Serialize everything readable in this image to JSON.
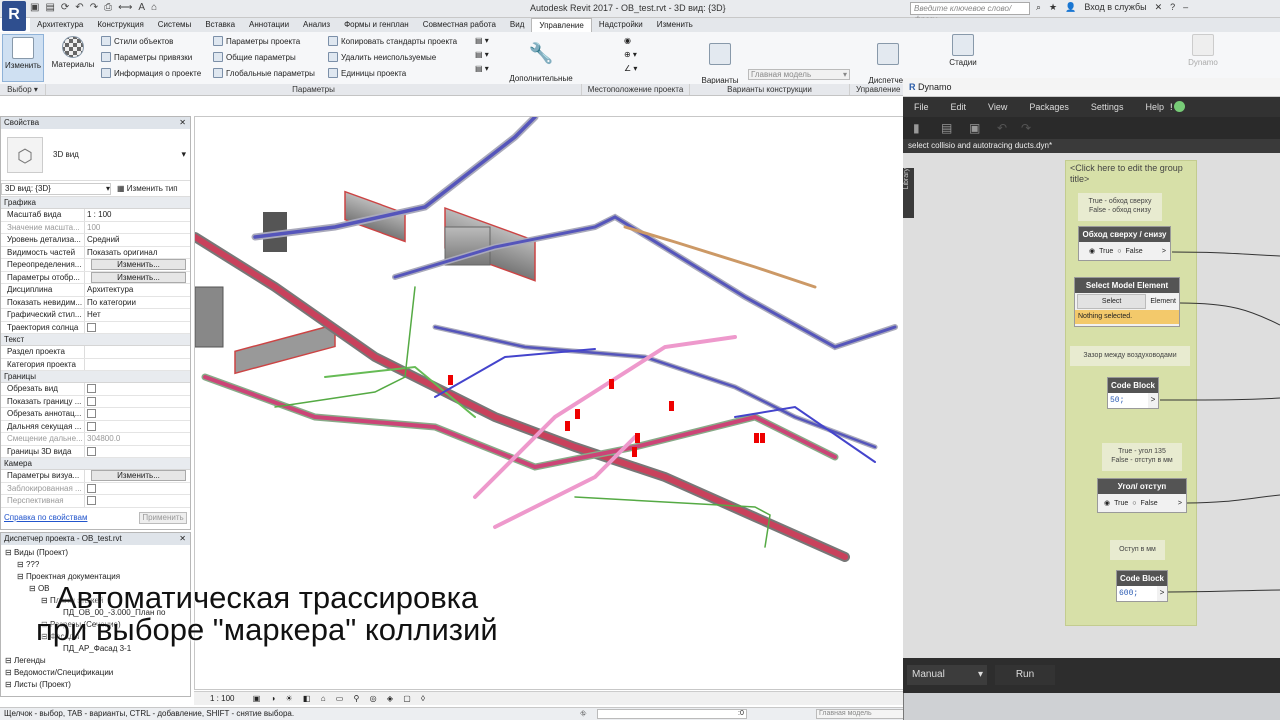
{
  "window": {
    "app_title": "Autodesk Revit 2017 -    ОВ_test.rvt - 3D вид: {3D}",
    "search_placeholder": "Введите ключевое слово/фразу",
    "sign_in": "Вход в службы"
  },
  "ribbon_tabs": [
    "Архитектура",
    "Конструкция",
    "Системы",
    "Вставка",
    "Аннотации",
    "Анализ",
    "Формы и генплан",
    "Совместная работа",
    "Вид",
    "Управление",
    "Надстройки",
    "Изменить"
  ],
  "active_tab": "Управление",
  "ribbon": {
    "modify": "Изменить",
    "materials": "Материалы",
    "object_styles": "Стили объектов",
    "snap_params": "Параметры привязки",
    "project_info": "Информация о проекте",
    "project_params": "Параметры проекта",
    "shared_params": "Общие параметры",
    "global_params": "Глобальные  параметры",
    "transfer_standards": "Копировать стандарты проекта",
    "purge_unused": "Удалить неиспользуемые",
    "project_units": "Единицы проекта",
    "additional_settings": "Дополнительные\nпараметры",
    "design_options": "Варианты\nконструкции",
    "main_model": "Главная модель",
    "links_manager": "Диспетчер\nсвязей",
    "phases": "Стадии",
    "dynamo": "Dynamo",
    "group_labels": {
      "select": "Выбор",
      "parameters": "Параметры",
      "location": "Местоположение проекта",
      "options": "Варианты конструкции",
      "manage": "Управление"
    }
  },
  "properties": {
    "title": "Свойства",
    "type_name": "3D вид",
    "instance_selector": "3D вид: {3D}",
    "edit_type": "Изменить тип",
    "categories": [
      {
        "name": "Графика",
        "rows": [
          {
            "k": "Масштаб вида",
            "v": "1 : 100"
          },
          {
            "k": "Значение масшта...",
            "v": "100",
            "disabled": true
          },
          {
            "k": "Уровень детализа...",
            "v": "Средний"
          },
          {
            "k": "Видимость частей",
            "v": "Показать оригинал"
          },
          {
            "k": "Переопределения...",
            "v": "Изменить...",
            "button": true
          },
          {
            "k": "Параметры отобр...",
            "v": "Изменить...",
            "button": true
          },
          {
            "k": "Дисциплина",
            "v": "Архитектура"
          },
          {
            "k": "Показать невидим...",
            "v": "По категории"
          },
          {
            "k": "Графический стил...",
            "v": "Нет"
          },
          {
            "k": "Траектория солнца",
            "v": "",
            "check": true
          }
        ]
      },
      {
        "name": "Текст",
        "rows": [
          {
            "k": "Раздел проекта",
            "v": ""
          },
          {
            "k": "Категория проекта",
            "v": ""
          }
        ]
      },
      {
        "name": "Границы",
        "rows": [
          {
            "k": "Обрезать вид",
            "v": "",
            "check": true
          },
          {
            "k": "Показать границу ...",
            "v": "",
            "check": true
          },
          {
            "k": "Обрезать аннотац...",
            "v": "",
            "check": true
          },
          {
            "k": "Дальняя секущая ...",
            "v": "",
            "check": true
          },
          {
            "k": "Смещение дальне...",
            "v": "304800.0",
            "disabled": true
          },
          {
            "k": "Границы 3D вида",
            "v": "",
            "check": true
          }
        ]
      },
      {
        "name": "Камера",
        "rows": [
          {
            "k": "Параметры визуа...",
            "v": "Изменить...",
            "button": true
          },
          {
            "k": "Заблокированная ...",
            "v": "",
            "check": true,
            "disabled": true
          },
          {
            "k": "Перспективная",
            "v": "",
            "check": true,
            "disabled": true
          }
        ]
      }
    ],
    "help_link": "Справка по свойствам",
    "apply": "Применить"
  },
  "project_browser": {
    "title": "Диспетчер проекта - ОВ_test.rvt",
    "items": [
      {
        "label": "Виды (Проект)",
        "level": 0
      },
      {
        "label": "???",
        "level": 1
      },
      {
        "label": "Проектная документация",
        "level": 1
      },
      {
        "label": "ОВ",
        "level": 2
      },
      {
        "label": "Планы этажей",
        "level": 3
      },
      {
        "label": "ПД_ОВ_00_-3.000_План по",
        "level": 4
      },
      {
        "label": "Разрезы (Сечение)",
        "level": 3
      },
      {
        "label": "Фасады",
        "level": 3
      },
      {
        "label": "ПД_АР_Фасад 3-1",
        "level": 4
      },
      {
        "label": "Легенды",
        "level": 0
      },
      {
        "label": "Ведомости/Спецификации",
        "level": 0
      },
      {
        "label": "Листы (Проект)",
        "level": 0
      }
    ]
  },
  "overlay_caption": {
    "line1": "Автоматическая трассировка",
    "line2": "при выборе \"маркера\" коллизий"
  },
  "view_controls": {
    "scale": "1 : 100"
  },
  "status": {
    "hint": "Щелчок - выбор, TAB - варианты, CTRL - добавление, SHIFT - снятие выбора.",
    "coords": ":0",
    "model": "Главная модель"
  },
  "dynamo": {
    "title": "Dynamo",
    "menu": [
      "File",
      "Edit",
      "View",
      "Packages",
      "Settings",
      "Help"
    ],
    "tab": "select collisio and autotracing ducts.dyn*",
    "library": "Library",
    "group_title": "<Click here to edit the group title>",
    "note1": "True - обход сверху\nFalse - обход снизу",
    "node_bool1": {
      "title": "Обход сверху / снизу",
      "true": "True",
      "false": "False"
    },
    "node_select": {
      "title": "Select Model Element",
      "button": "Select",
      "output": "Element",
      "status": "Nothing selected."
    },
    "note2": "Зазор между воздуховодами",
    "node_code1": {
      "title": "Code Block",
      "value": "50;"
    },
    "note3": "True - угол 135\nFalse - отступ в мм",
    "node_bool2": {
      "title": "Угол/ отступ",
      "true": "True",
      "false": "False"
    },
    "note4": "Оступ в мм",
    "node_code2": {
      "title": "Code Block",
      "value": "600;"
    },
    "run_mode": "Manual",
    "run": "Run"
  }
}
